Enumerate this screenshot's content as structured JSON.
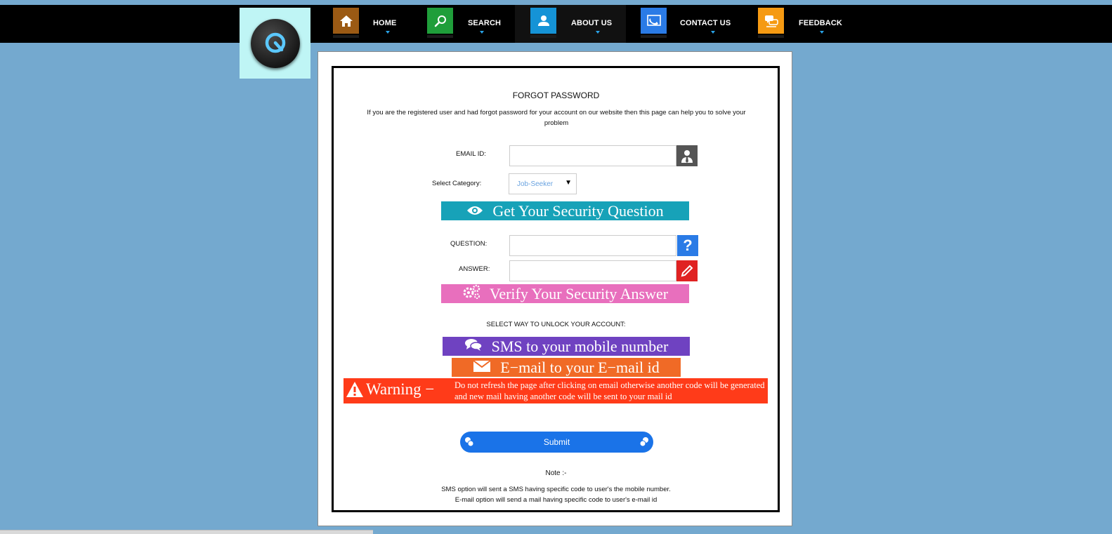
{
  "nav": {
    "items": [
      {
        "label": "HOME",
        "icon": "home-icon",
        "color": "#9b5a14"
      },
      {
        "label": "SEARCH",
        "icon": "search-icon",
        "color": "#1f9e3a"
      },
      {
        "label": "ABOUT US",
        "icon": "user-icon",
        "color": "#1593d6",
        "active": true
      },
      {
        "label": "CONTACT US",
        "icon": "contact-icon",
        "color": "#2a7be6"
      },
      {
        "label": "FEEDBACK",
        "icon": "feedback-icon",
        "color": "#f59a12"
      }
    ]
  },
  "logo": {
    "icon": "q-logo-icon"
  },
  "form": {
    "title": "FORGOT PASSWORD",
    "description": "If you are the registered user and had forgot password for your account on our website then this page can help you to solve your problem",
    "email_label": "EMAIL ID:",
    "email_value": "",
    "category_label": "Select Category:",
    "category_value": "Job-Seeker",
    "get_question_label": "Get Your Security Question",
    "question_label": "QUESTION:",
    "question_value": "",
    "answer_label": "ANSWER:",
    "answer_value": "",
    "verify_label": "Verify Your Security Answer",
    "unlock_label": "SELECT WAY TO UNLOCK YOUR ACCOUNT:",
    "sms_label": "SMS to your mobile number",
    "email_option_label": "E−mail to your E−mail id",
    "warning_title": "Warning −",
    "warning_text": "Do not refresh the page after clicking on email otherwise another code will be generated and new mail having another code will be sent to your mail id",
    "submit_label": "Submit",
    "note_title": "Note :-",
    "note_line1": "SMS option will sent a SMS having specific code to user's the mobile number.",
    "note_line2": "E-mail option will send a mail having specific code to user's e-mail id"
  },
  "colors": {
    "page_bg": "#74a9cf",
    "get_question_btn": "#17a2b8",
    "verify_btn": "#e86fbd",
    "sms_btn": "#6f42c1",
    "email_btn": "#f06a26",
    "warning": "#ff3b19",
    "submit": "#1a73e8"
  }
}
